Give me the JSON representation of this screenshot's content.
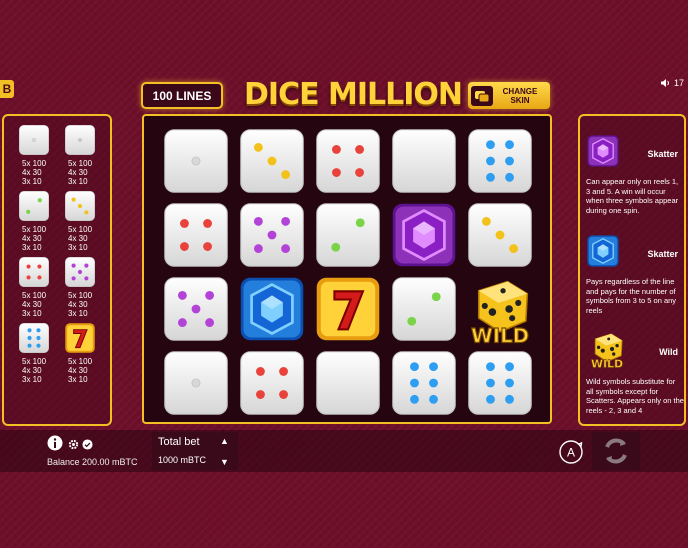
{
  "header": {
    "corner_badge": "B",
    "lines_label": "100 LINES",
    "title": "DICE MILLION",
    "change_skin_label": "CHANGE SKIN",
    "sound_level": "17"
  },
  "paytable": [
    {
      "symbol": "dice-1",
      "lines": [
        "5x 100",
        "4x 30",
        "3x 10"
      ]
    },
    {
      "symbol": "dice-1-gray",
      "lines": [
        "5x 100",
        "4x 30",
        "3x 10"
      ]
    },
    {
      "symbol": "dice-2-green",
      "lines": [
        "5x 100",
        "4x 30",
        "3x 10"
      ]
    },
    {
      "symbol": "dice-3-yellow",
      "lines": [
        "5x 100",
        "4x 30",
        "3x 10"
      ]
    },
    {
      "symbol": "dice-4-red",
      "lines": [
        "5x 100",
        "4x 30",
        "3x 10"
      ]
    },
    {
      "symbol": "dice-5-purple",
      "lines": [
        "5x 100",
        "4x 30",
        "3x 10"
      ]
    },
    {
      "symbol": "dice-6-blue",
      "lines": [
        "5x 100",
        "4x 30",
        "3x 10"
      ]
    },
    {
      "symbol": "seven",
      "lines": [
        "5x 100",
        "4x 30",
        "3x 10"
      ]
    }
  ],
  "reels": [
    [
      "dice-1",
      "dice-3-yellow",
      "dice-4-red",
      "dice-0",
      "dice-6-blue"
    ],
    [
      "dice-4-red",
      "dice-5-purple",
      "dice-2-green",
      "gem-purple",
      "dice-3-yellow"
    ],
    [
      "dice-5-purple",
      "gem-blue",
      "seven",
      "dice-2-green",
      "wild"
    ],
    [
      "dice-1",
      "dice-4-red",
      "dice-0",
      "dice-6-blue",
      "dice-6-blue"
    ]
  ],
  "info": {
    "skatter_purple": {
      "name": "Skatter",
      "text": "Can appear only on reels 1, 3 and 5. A win will occur when three symbols appear during one spin."
    },
    "skatter_blue": {
      "name": "Skatter",
      "text": "Pays regardless of the line and pays for the number of symbols from 3 to 5 on any reels"
    },
    "wild": {
      "name": "Wild",
      "text": "Wild symbols substitute for all symbols except for Scatters. Appears only on the reels - 2, 3 and 4",
      "badge": "WILD"
    }
  },
  "bottom": {
    "balance": "Balance 200.00 mBTC",
    "total_bet_label": "Total bet",
    "total_bet_value": "1000 mBTC",
    "bet_up": "▲",
    "bet_down": "▼",
    "auto_label": "A"
  },
  "colors": {
    "background": "#6e0f2a",
    "gold": "#f2c025",
    "red_pip": "#e8423a",
    "green_pip": "#7bd34a",
    "yellow_pip": "#f3c21a",
    "purple_pip": "#b342d6",
    "blue_pip": "#2e9ef0"
  }
}
